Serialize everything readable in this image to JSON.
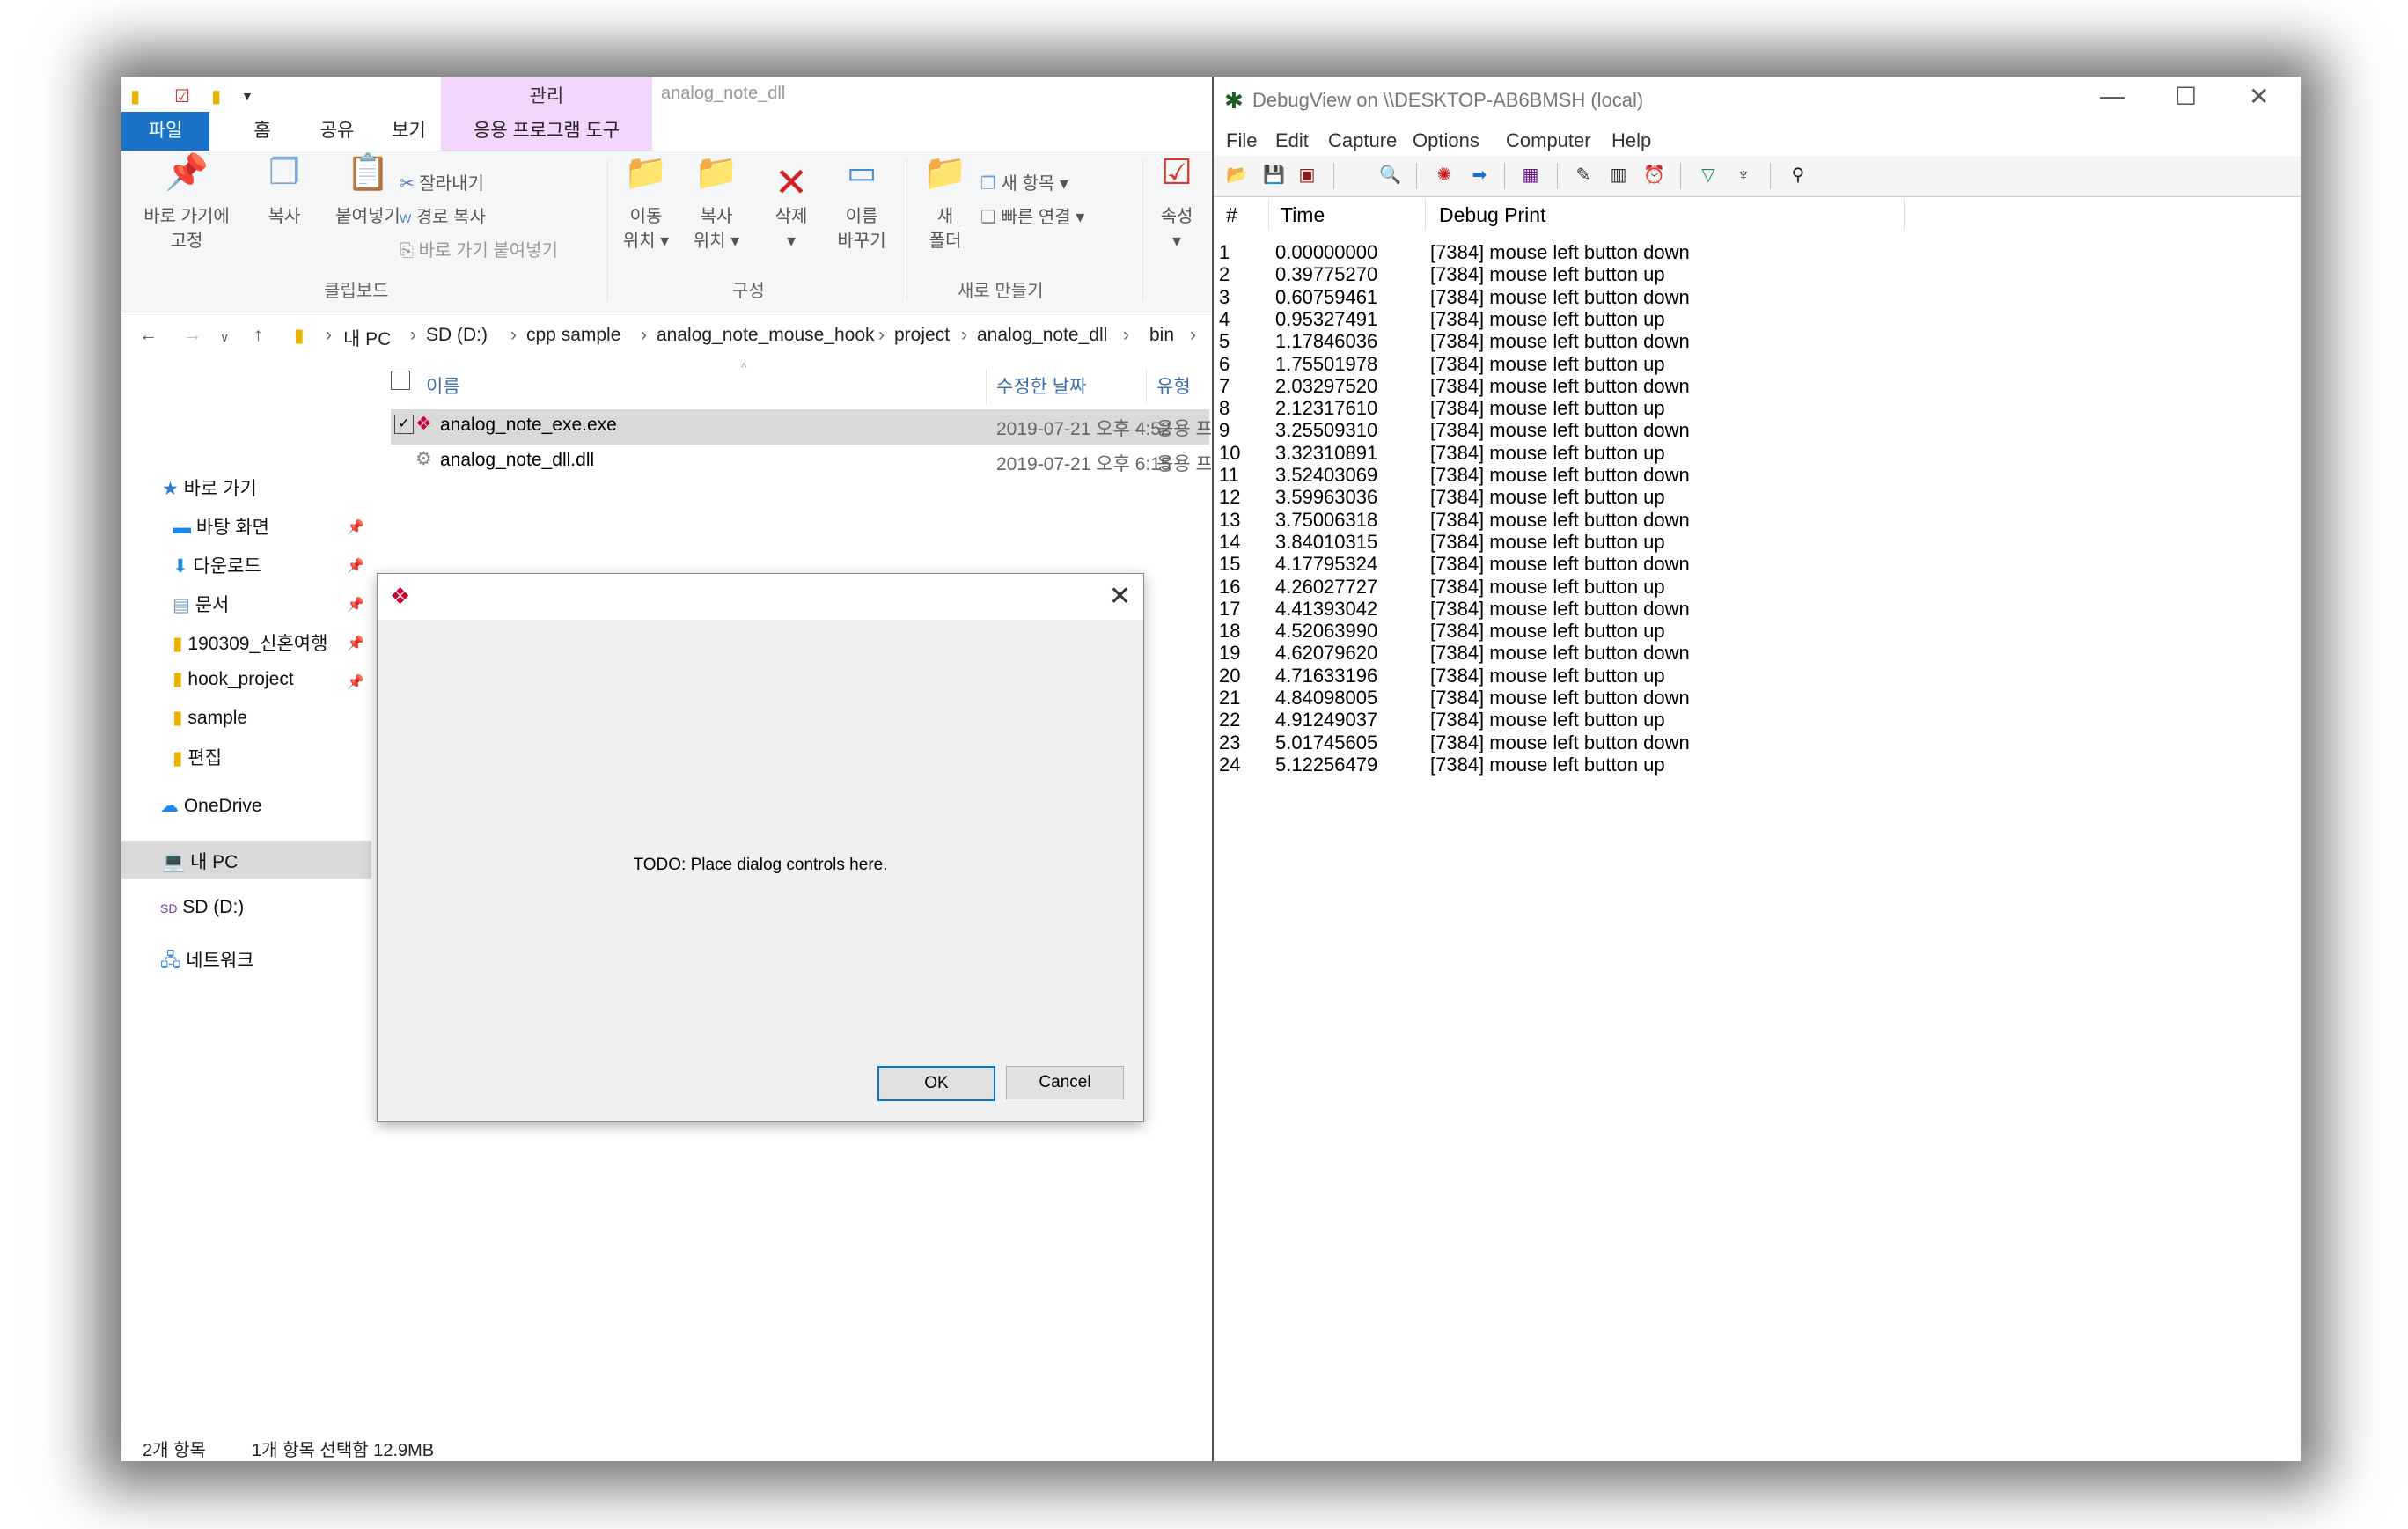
{
  "explorer": {
    "qa_title": "analog_note_dll",
    "manage_tab": "관리",
    "tabs": [
      "파일",
      "홈",
      "공유",
      "보기",
      "응용 프로그램 도구"
    ],
    "ribbon": {
      "pin_label_1": "바로 가기에",
      "pin_label_2": "고정",
      "copy": "복사",
      "paste": "붙여넣기",
      "cut": "잘라내기",
      "copy_path": "경로 복사",
      "paste_shortcut": "바로 가기 붙여넣기",
      "group_clipboard": "클립보드",
      "move_to_1": "이동",
      "move_to_2": "위치",
      "copy_to_1": "복사",
      "copy_to_2": "위치",
      "delete": "삭제",
      "rename_1": "이름",
      "rename_2": "바꾸기",
      "group_organize": "구성",
      "new_folder_1": "새",
      "new_folder_2": "폴더",
      "new_item": "새 항목",
      "easy_access": "빠른 연결",
      "group_new": "새로 만들기",
      "properties": "속성"
    },
    "breadcrumb": [
      "내 PC",
      "SD (D:)",
      "cpp sample",
      "analog_note_mouse_hook",
      "project",
      "analog_note_dll",
      "bin"
    ],
    "nav": {
      "quick_access": "바로 가기",
      "items": [
        "바탕 화면",
        "다운로드",
        "문서",
        "190309_신혼여행",
        "hook_project",
        "sample",
        "편집"
      ],
      "onedrive": "OneDrive",
      "this_pc": "내 PC",
      "sd": "SD (D:)",
      "network": "네트워크"
    },
    "columns": {
      "name": "이름",
      "modified": "수정한 날짜",
      "type": "유형"
    },
    "files": [
      {
        "name": "analog_note_exe.exe",
        "modified": "2019-07-21 오후 4:52",
        "type": "응용 프로"
      },
      {
        "name": "analog_note_dll.dll",
        "modified": "2019-07-21 오후 6:15",
        "type": "응용 프로"
      }
    ],
    "status": {
      "count": "2개 항목",
      "selected": "1개 항목 선택함 12.9MB"
    }
  },
  "dialog": {
    "message": "TODO: Place dialog controls here.",
    "ok": "OK",
    "cancel": "Cancel"
  },
  "debugview": {
    "title": "DebugView on \\\\DESKTOP-AB6BMSH (local)",
    "menu": [
      "File",
      "Edit",
      "Capture",
      "Options",
      "Computer",
      "Help"
    ],
    "columns": {
      "num": "#",
      "time": "Time",
      "print": "Debug Print"
    },
    "rows": [
      [
        "1",
        "0.00000000",
        "[7384] mouse left button down"
      ],
      [
        "2",
        "0.39775270",
        "[7384] mouse left button up"
      ],
      [
        "3",
        "0.60759461",
        "[7384] mouse left button down"
      ],
      [
        "4",
        "0.95327491",
        "[7384] mouse left button up"
      ],
      [
        "5",
        "1.17846036",
        "[7384] mouse left button down"
      ],
      [
        "6",
        "1.75501978",
        "[7384] mouse left button up"
      ],
      [
        "7",
        "2.03297520",
        "[7384] mouse left button down"
      ],
      [
        "8",
        "2.12317610",
        "[7384] mouse left button up"
      ],
      [
        "9",
        "3.25509310",
        "[7384] mouse left button down"
      ],
      [
        "10",
        "3.32310891",
        "[7384] mouse left button up"
      ],
      [
        "11",
        "3.52403069",
        "[7384] mouse left button down"
      ],
      [
        "12",
        "3.59963036",
        "[7384] mouse left button up"
      ],
      [
        "13",
        "3.75006318",
        "[7384] mouse left button down"
      ],
      [
        "14",
        "3.84010315",
        "[7384] mouse left button up"
      ],
      [
        "15",
        "4.17795324",
        "[7384] mouse left button down"
      ],
      [
        "16",
        "4.26027727",
        "[7384] mouse left button up"
      ],
      [
        "17",
        "4.41393042",
        "[7384] mouse left button down"
      ],
      [
        "18",
        "4.52063990",
        "[7384] mouse left button up"
      ],
      [
        "19",
        "4.62079620",
        "[7384] mouse left button down"
      ],
      [
        "20",
        "4.71633196",
        "[7384] mouse left button up"
      ],
      [
        "21",
        "4.84098005",
        "[7384] mouse left button down"
      ],
      [
        "22",
        "4.91249037",
        "[7384] mouse left button up"
      ],
      [
        "23",
        "5.01745605",
        "[7384] mouse left button down"
      ],
      [
        "24",
        "5.12256479",
        "[7384] mouse left button up"
      ]
    ]
  }
}
